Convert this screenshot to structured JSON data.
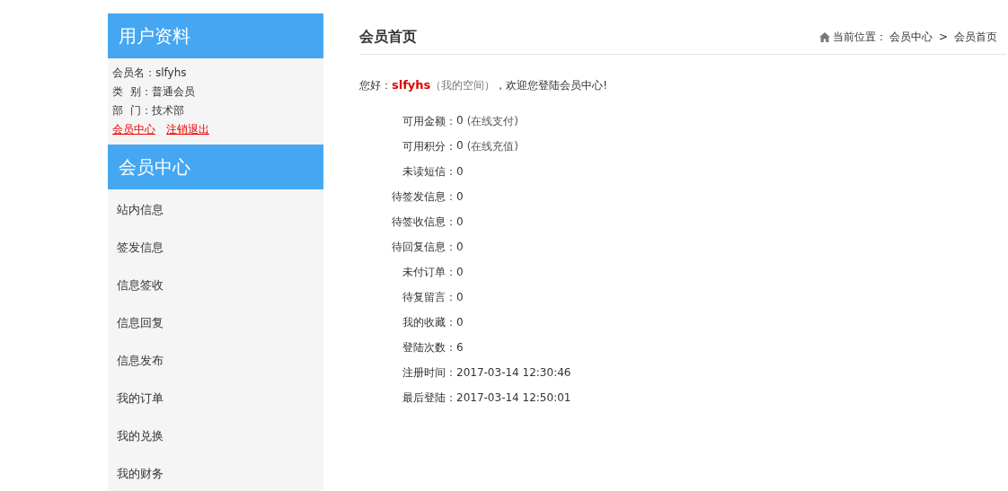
{
  "sidebar": {
    "profile_title": "用户资料",
    "profile": [
      {
        "label": "会员名：",
        "value": "slfyhs"
      },
      {
        "label": "类  别：",
        "value": "普通会员"
      },
      {
        "label": "部  门：",
        "value": "技术部"
      }
    ],
    "links": [
      "会员中心",
      "注销退出"
    ],
    "menu_title": "会员中心",
    "menu": [
      "站内信息",
      "签发信息",
      "信息签收",
      "信息回复",
      "信息发布",
      "我的订单",
      "我的兑换",
      "我的财务"
    ]
  },
  "main": {
    "title": "会员首页",
    "breadcrumb": {
      "label": "当前位置：",
      "items": [
        "会员中心",
        "会员首页"
      ],
      "separator": ">"
    },
    "greeting": {
      "prefix": "您好：",
      "username": "slfyhs",
      "space_link": "（我的空间）",
      "suffix": "，欢迎您登陆会员中心!"
    },
    "stats": [
      {
        "label": "可用金额：",
        "value": "0",
        "note": "(在线支付)"
      },
      {
        "label": "可用积分：",
        "value": "0",
        "note": "(在线充值)"
      },
      {
        "label": "未读短信：",
        "value": "0"
      },
      {
        "label": "待签发信息：",
        "value": "0"
      },
      {
        "label": "待签收信息：",
        "value": "0"
      },
      {
        "label": "待回复信息：",
        "value": "0"
      },
      {
        "label": "未付订单：",
        "value": "0"
      },
      {
        "label": "待复留言：",
        "value": "0"
      },
      {
        "label": "我的收藏：",
        "value": "0"
      },
      {
        "label": "登陆次数：",
        "value": "6"
      },
      {
        "label": "注册时间：",
        "value": "2017-03-14 12:30:46"
      },
      {
        "label": "最后登陆：",
        "value": "2017-03-14 12:50:01"
      }
    ]
  }
}
